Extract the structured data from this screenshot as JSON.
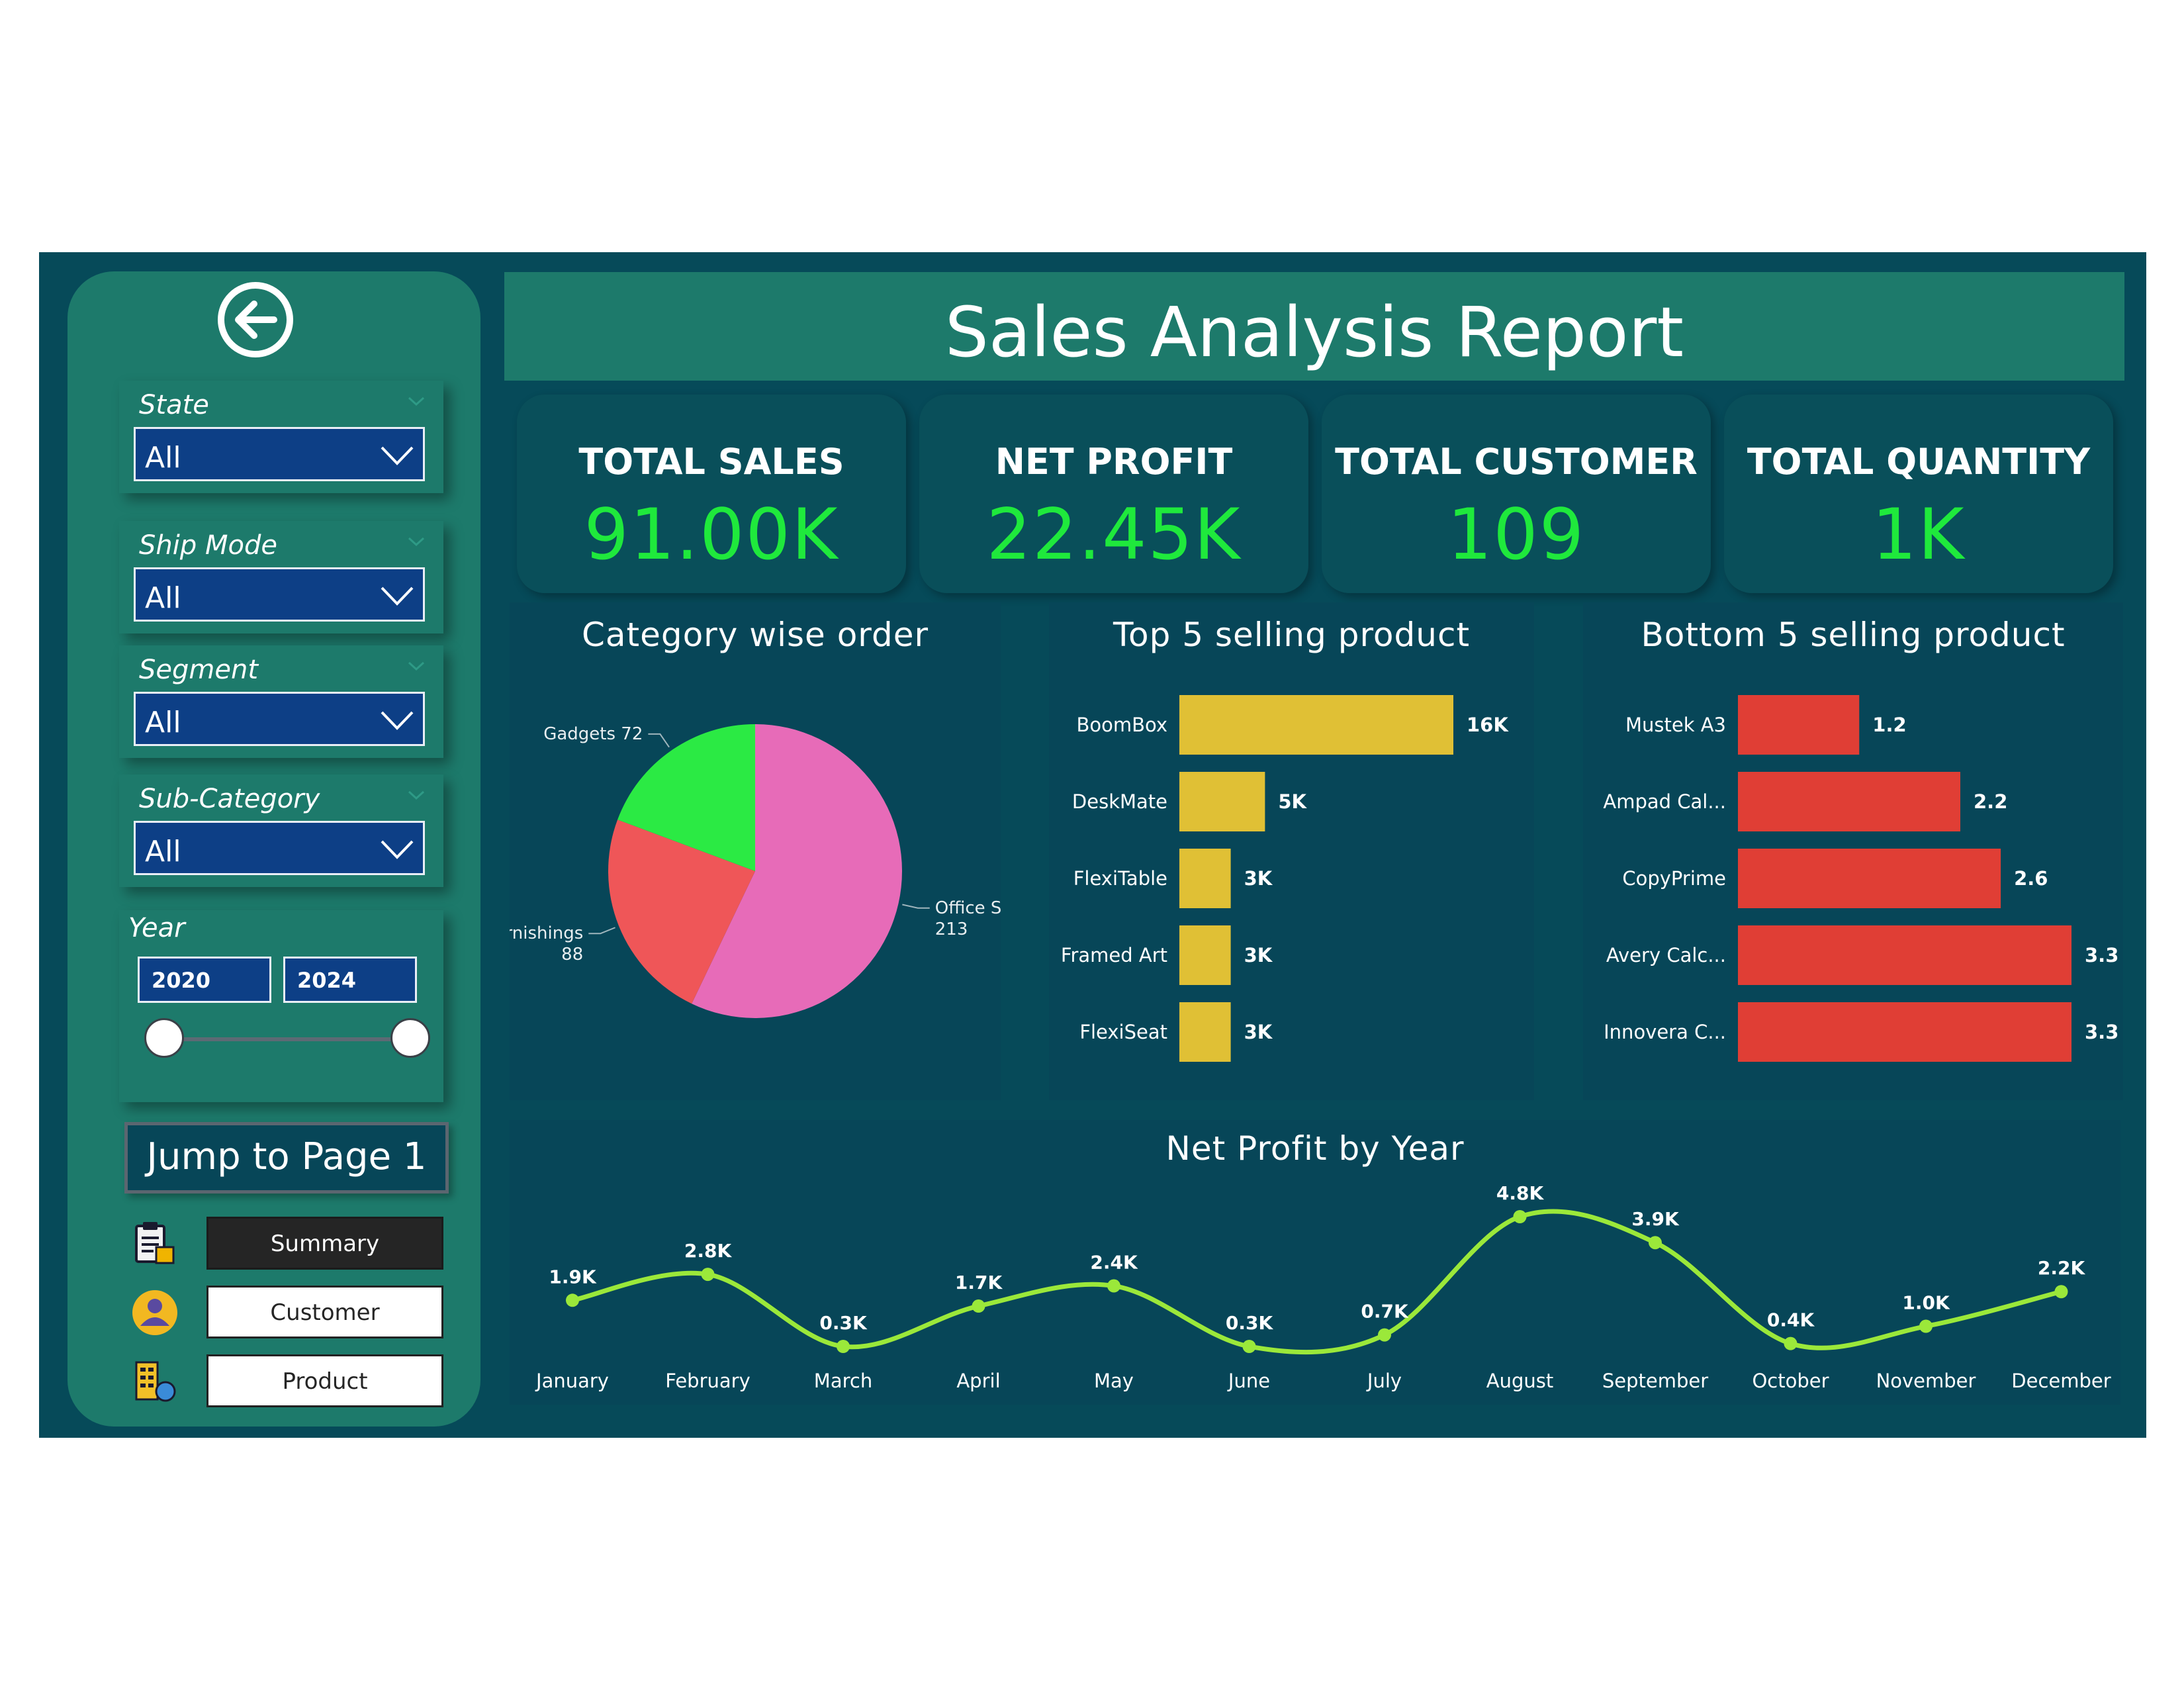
{
  "header": {
    "title": "Sales Analysis Report"
  },
  "filters": {
    "state": {
      "label": "State",
      "value": "All"
    },
    "ship_mode": {
      "label": "Ship Mode",
      "value": "All"
    },
    "segment": {
      "label": "Segment",
      "value": "All"
    },
    "sub_category": {
      "label": "Sub-Category",
      "value": "All"
    },
    "year": {
      "label": "Year",
      "from": "2020",
      "to": "2024"
    }
  },
  "navigation": {
    "jump_label": "Jump to Page 1",
    "pages": [
      {
        "label": "Summary",
        "active": true,
        "icon": "clipboard-icon"
      },
      {
        "label": "Customer",
        "active": false,
        "icon": "customer-icon"
      },
      {
        "label": "Product",
        "active": false,
        "icon": "product-icon"
      }
    ],
    "back_icon": "back-arrow-icon"
  },
  "kpis": [
    {
      "label": "TOTAL SALES",
      "value": "91.00K"
    },
    {
      "label": "NET PROFIT",
      "value": "22.45K"
    },
    {
      "label": "TOTAL CUSTOMER",
      "value": "109"
    },
    {
      "label": "TOTAL QUANTITY",
      "value": "1K"
    }
  ],
  "colors": {
    "background": "#064a59",
    "accent": "#1d7a6b",
    "kpi_value": "#1fe93c",
    "top_bar": "#e0c035",
    "bottom_bar": "#e03e35",
    "line": "#9be83a"
  },
  "chart_data": [
    {
      "type": "pie",
      "title": "Category wise order",
      "categories": [
        "Office Supplies",
        "Furnishings",
        "Gadgets"
      ],
      "values": [
        213,
        88,
        72
      ],
      "colors": [
        "#e76bb8",
        "#ef5658",
        "#2bea44"
      ],
      "labels": [
        "Office Supplies",
        "Furnishings",
        "Gadgets 72"
      ]
    },
    {
      "type": "bar",
      "title": "Top 5 selling product",
      "categories": [
        "BoomBox",
        "DeskMate",
        "FlexiTable",
        "Framed Art",
        "FlexiSeat"
      ],
      "values": [
        16000,
        5000,
        3000,
        3000,
        3000
      ],
      "data_labels": [
        "16K",
        "5K",
        "3K",
        "3K",
        "3K"
      ],
      "color": "#e0c035"
    },
    {
      "type": "bar",
      "title": "Bottom 5 selling product",
      "categories": [
        "Mustek A3",
        "Ampad Cal...",
        "CopyPrime",
        "Avery Calc...",
        "Innovera C..."
      ],
      "values": [
        1.2,
        2.2,
        2.6,
        3.3,
        3.3
      ],
      "data_labels": [
        "1.2",
        "2.2",
        "2.6",
        "3.3",
        "3.3"
      ],
      "color": "#e03e35"
    },
    {
      "type": "line",
      "title": "Net Profit by Year",
      "x": [
        "January",
        "February",
        "March",
        "April",
        "May",
        "June",
        "July",
        "August",
        "September",
        "October",
        "November",
        "December"
      ],
      "values": [
        1900,
        2800,
        300,
        1700,
        2400,
        300,
        700,
        4800,
        3900,
        400,
        1000,
        2200
      ],
      "data_labels": [
        "1.9K",
        "2.8K",
        "0.3K",
        "1.7K",
        "2.4K",
        "0.3K",
        "0.7K",
        "4.8K",
        "3.9K",
        "0.4K",
        "1.0K",
        "2.2K"
      ],
      "color": "#9be83a"
    }
  ]
}
